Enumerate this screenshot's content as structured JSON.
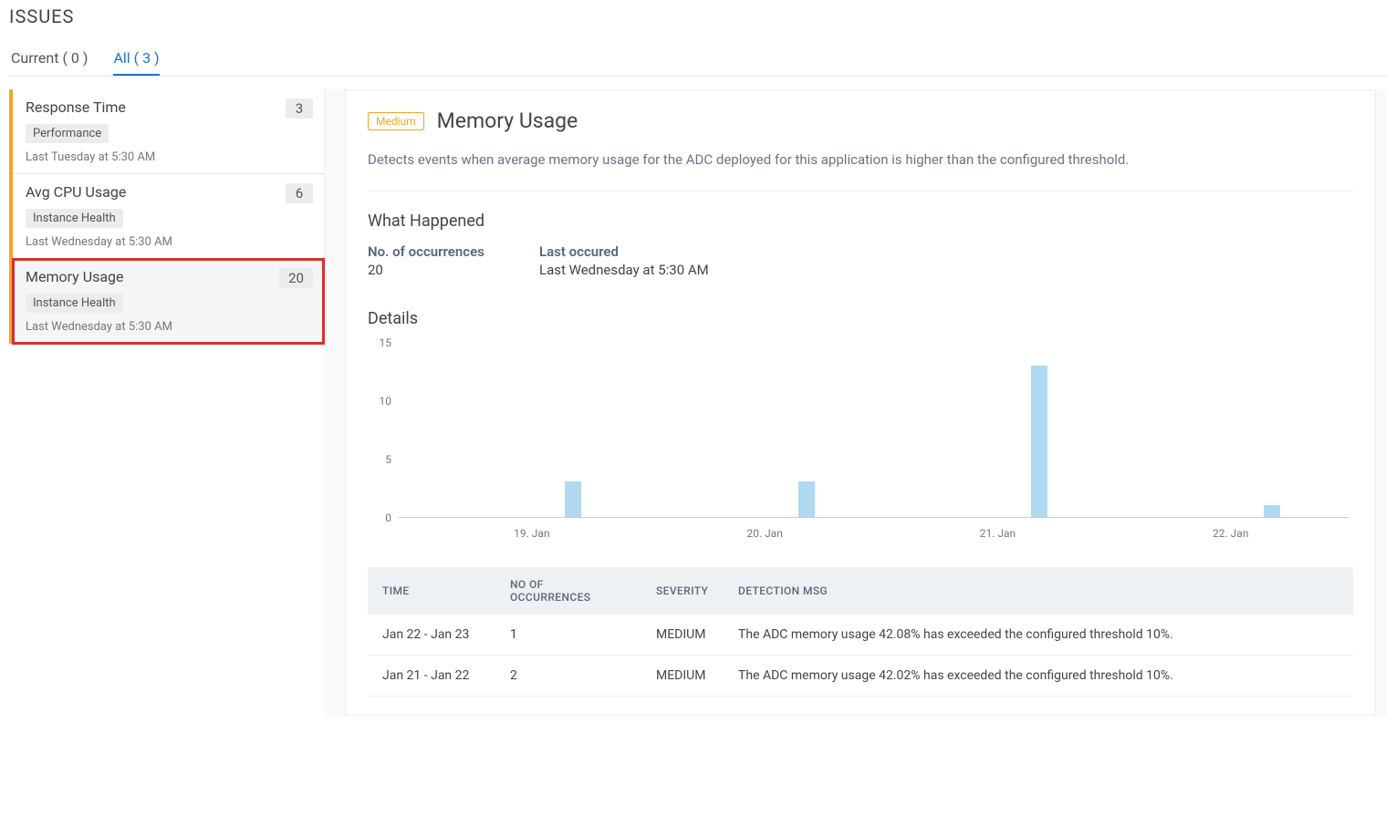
{
  "page_title": "ISSUES",
  "tabs": [
    {
      "label": "Current ( 0 )",
      "active": false
    },
    {
      "label": "All ( 3 )",
      "active": true
    }
  ],
  "issues": [
    {
      "title": "Response Time",
      "category": "Performance",
      "timestamp": "Last Tuesday at 5:30 AM",
      "count": "3",
      "selected": false
    },
    {
      "title": "Avg CPU Usage",
      "category": "Instance Health",
      "timestamp": "Last Wednesday at 5:30 AM",
      "count": "6",
      "selected": false
    },
    {
      "title": "Memory Usage",
      "category": "Instance Health",
      "timestamp": "Last Wednesday at 5:30 AM",
      "count": "20",
      "selected": true
    }
  ],
  "detail": {
    "severity_badge": "Medium",
    "title": "Memory Usage",
    "description": "Detects events when average memory usage for the ADC deployed for this application is higher than the configured threshold.",
    "what_happened_heading": "What Happened",
    "occurrences_label": "No. of occurrences",
    "occurrences_value": "20",
    "last_occurred_label": "Last occured",
    "last_occurred_value": "Last Wednesday at 5:30 AM",
    "details_heading": "Details"
  },
  "chart_data": {
    "type": "bar",
    "yticks": [
      15,
      10,
      5,
      0
    ],
    "ylim": [
      0,
      15
    ],
    "x_labels": [
      "19. Jan",
      "20. Jan",
      "21. Jan",
      "22. Jan"
    ],
    "x_label_positions_pct": [
      14,
      38.5,
      63,
      87.5
    ],
    "bar_positions_pct": [
      17.5,
      42,
      66.5,
      91
    ],
    "values": [
      3,
      3,
      13,
      1
    ]
  },
  "table": {
    "columns": [
      "TIME",
      "NO OF OCCURRENCES",
      "SEVERITY",
      "DETECTION MSG"
    ],
    "rows": [
      [
        "Jan 22 - Jan 23",
        "1",
        "MEDIUM",
        "The ADC memory usage 42.08% has exceeded the configured threshold 10%."
      ],
      [
        "Jan 21 - Jan 22",
        "2",
        "MEDIUM",
        "The ADC memory usage 42.02% has exceeded the configured threshold 10%."
      ]
    ]
  }
}
